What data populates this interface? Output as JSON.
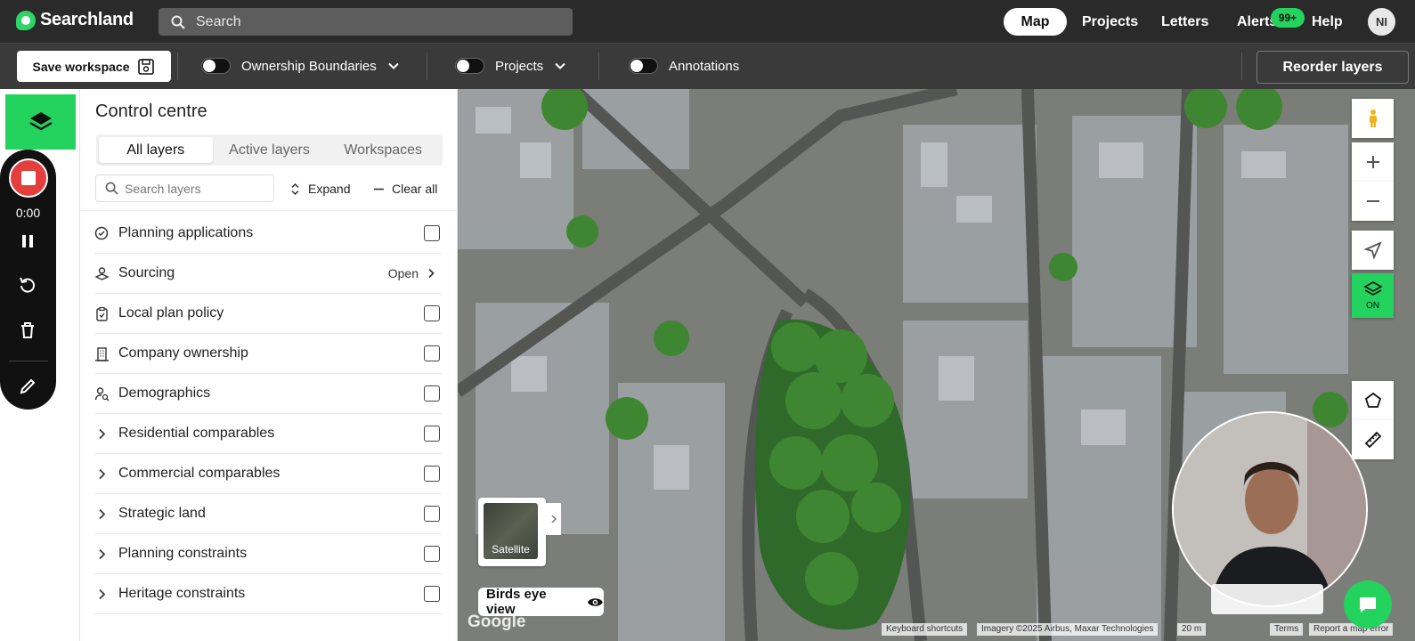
{
  "app": {
    "name": "Searchland",
    "search_placeholder": "Search"
  },
  "nav": {
    "map": "Map",
    "projects": "Projects",
    "letters": "Letters",
    "alerts": "Alerts",
    "alerts_badge": "99+",
    "help": "Help",
    "avatar_initials": "NI"
  },
  "toolbar": {
    "save_workspace": "Save workspace",
    "ownership": "Ownership Boundaries",
    "projects": "Projects",
    "annotations": "Annotations",
    "reorder_layers": "Reorder layers"
  },
  "recorder": {
    "time": "0:00"
  },
  "panel": {
    "title": "Control centre",
    "tabs": [
      "All layers",
      "Active layers",
      "Workspaces"
    ],
    "search_placeholder": "Search layers",
    "expand": "Expand",
    "clear_all": "Clear all",
    "layers": [
      {
        "label": "Planning applications",
        "icon": "search-doc-icon"
      },
      {
        "label": "Sourcing",
        "icon": "sourcing-icon",
        "action": "Open"
      },
      {
        "label": "Local plan policy",
        "icon": "clipboard-icon"
      },
      {
        "label": "Company ownership",
        "icon": "building-icon"
      },
      {
        "label": "Demographics",
        "icon": "person-search-icon"
      },
      {
        "label": "Residential comparables",
        "icon": "chevron-right-icon"
      },
      {
        "label": "Commercial comparables",
        "icon": "chevron-right-icon"
      },
      {
        "label": "Strategic land",
        "icon": "chevron-right-icon"
      },
      {
        "label": "Planning constraints",
        "icon": "chevron-right-icon"
      },
      {
        "label": "Heritage constraints",
        "icon": "chevron-right-icon"
      }
    ]
  },
  "map": {
    "layer_toggle_state": "ON",
    "basemap_label": "Satellite",
    "birds_eye": "Birds eye view",
    "google": "Google",
    "attribution": {
      "shortcuts": "Keyboard shortcuts",
      "imagery": "Imagery ©2025 Airbus, Maxar Technologies",
      "scale": "20 m",
      "terms": "Terms",
      "report": "Report a map error"
    }
  },
  "colors": {
    "brand_green": "#24d35d",
    "topbar": "#2a2a2a",
    "toolbar": "#3a3a3a",
    "record_red": "#e53e3e"
  }
}
